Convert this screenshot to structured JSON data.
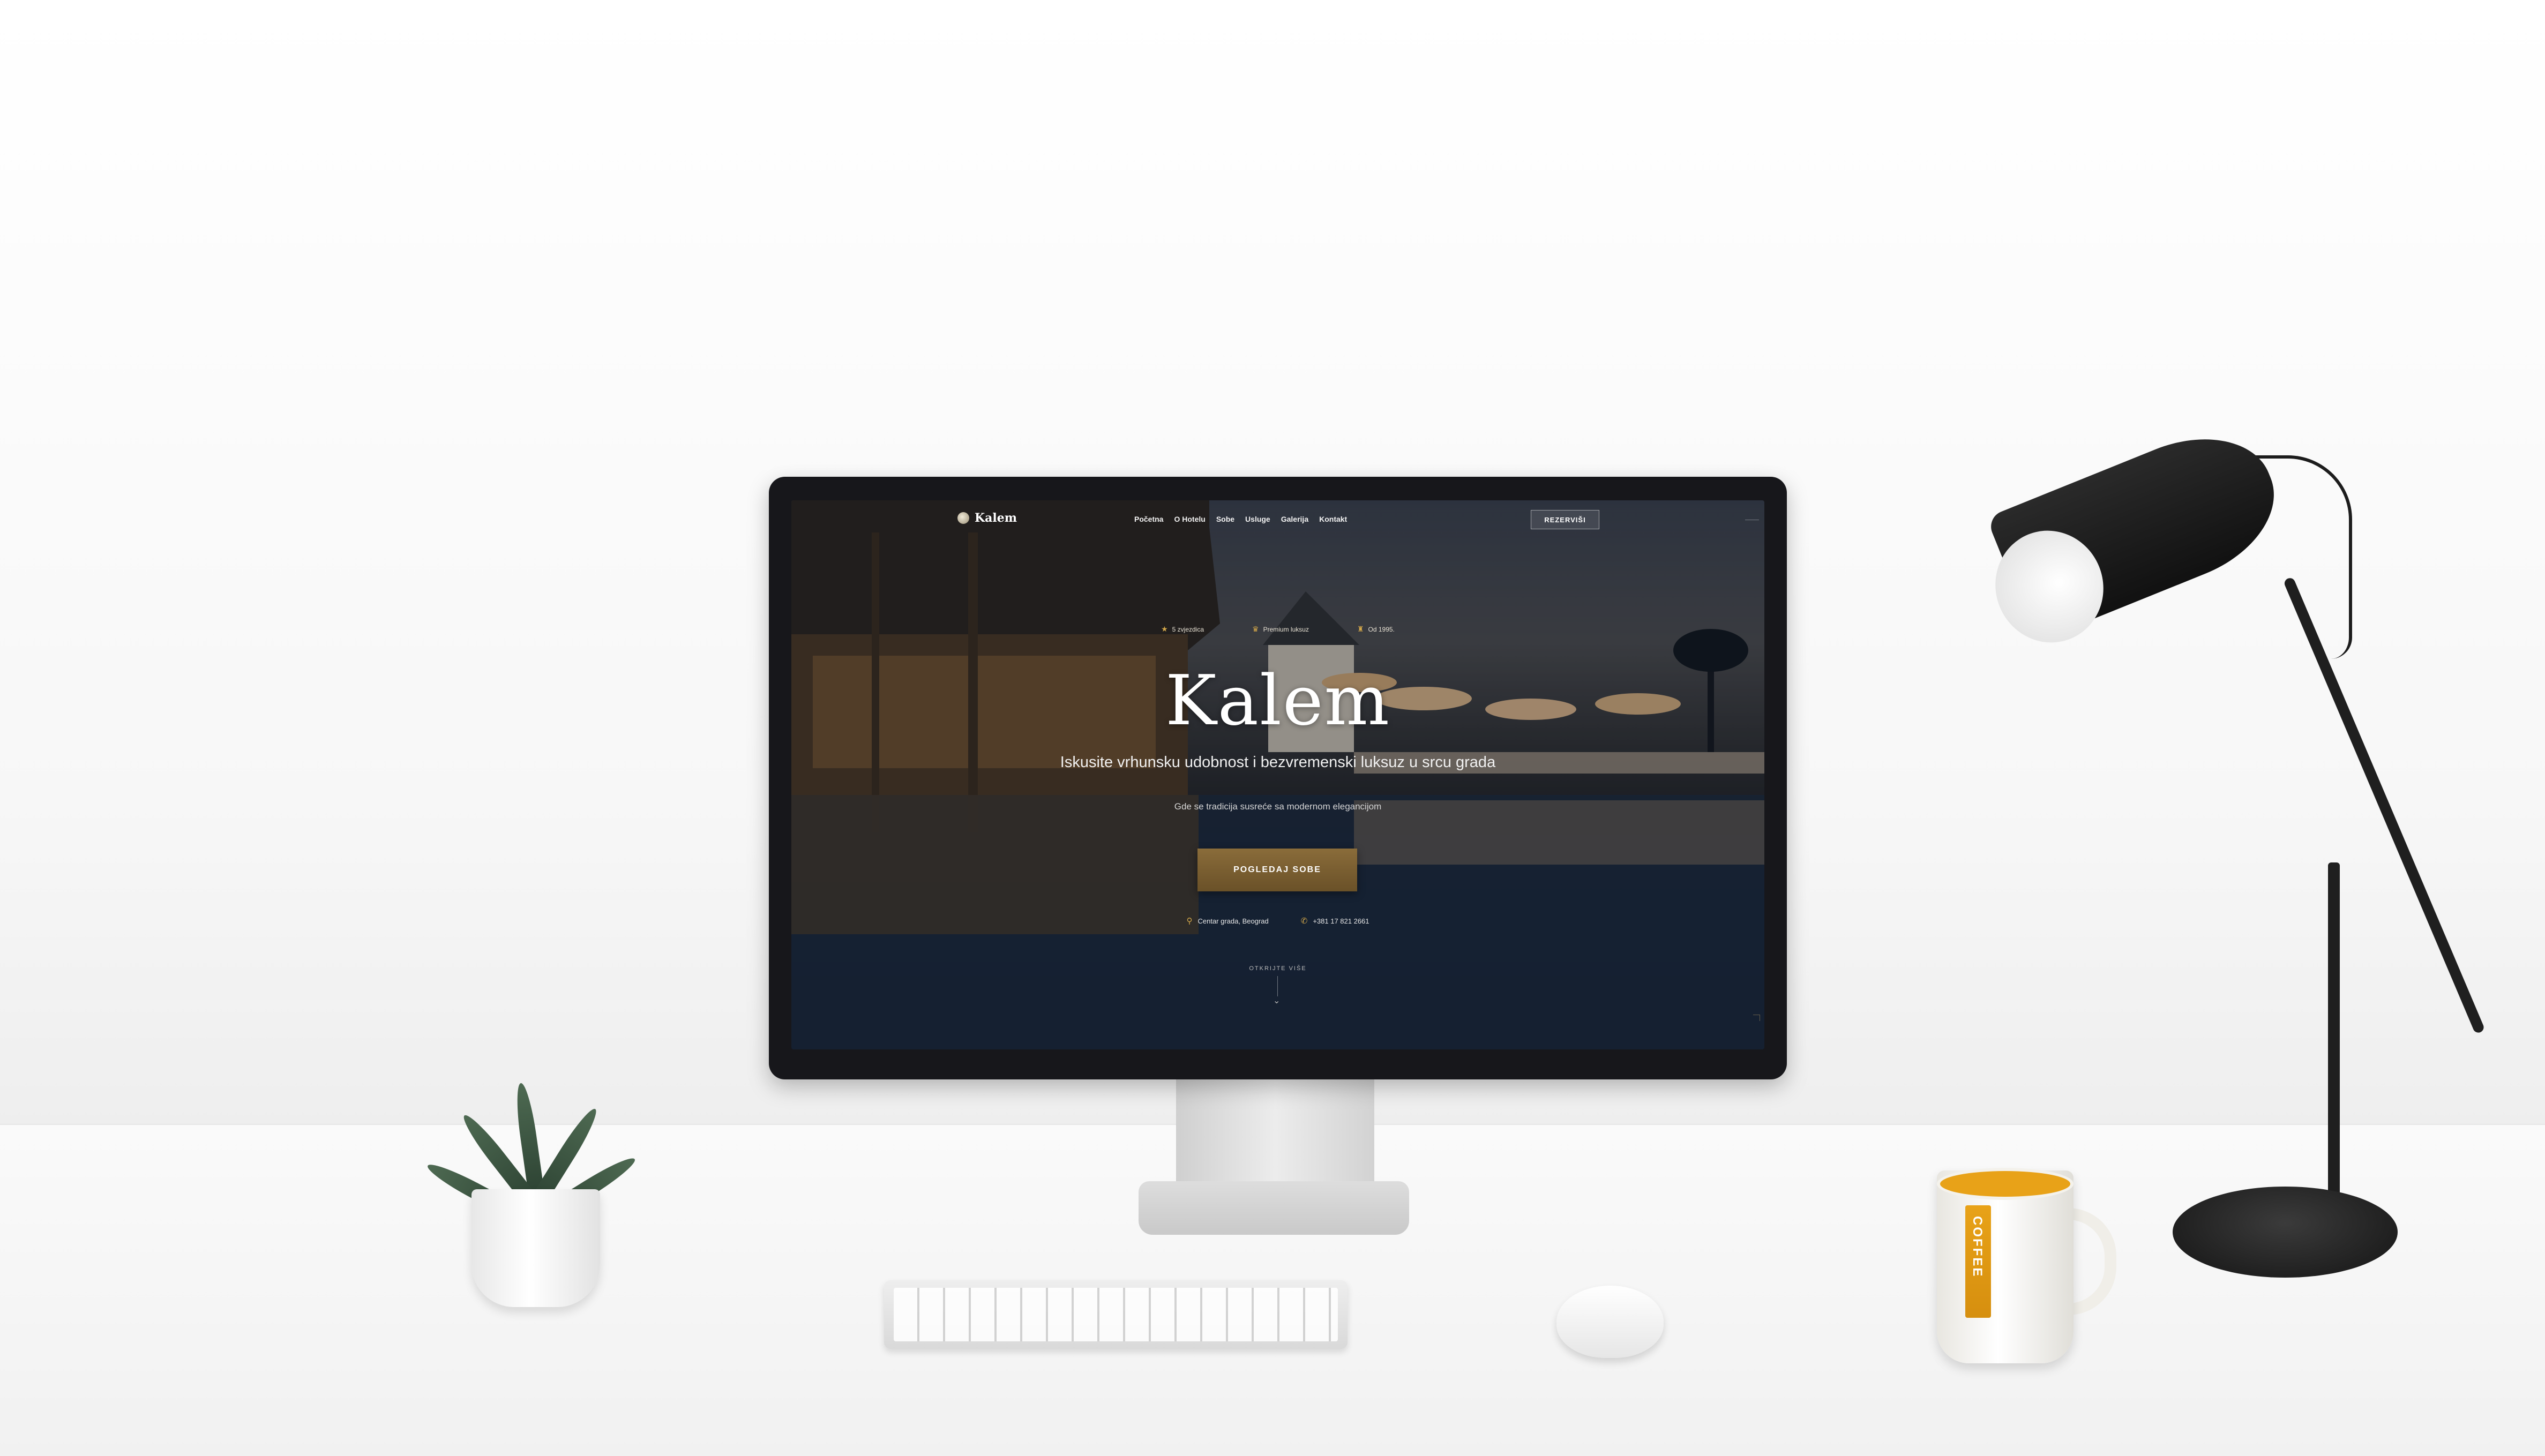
{
  "website": {
    "brand": "Kalem",
    "nav": [
      "Početna",
      "O Hotelu",
      "Sobe",
      "Usluge",
      "Galerija",
      "Kontakt"
    ],
    "book_button": "REZERVIŠI",
    "badges": [
      {
        "icon": "star-icon",
        "label": "5 zvjezdica"
      },
      {
        "icon": "crown-icon",
        "label": "Premium luksuz"
      },
      {
        "icon": "award-icon",
        "label": "Od 1995."
      }
    ],
    "hero_title": "Kalem",
    "hero_subtitle": "Iskusite vrhunsku udobnost i bezvremenski luksuz u srcu grada",
    "hero_tagline": "Gde se tradicija susreće sa modernom elegancijom",
    "cta": "POGLEDAJ SOBE",
    "contact": {
      "location_icon": "map-pin-icon",
      "location": "Centar grada, Beograd",
      "phone_icon": "phone-icon",
      "phone": "+381 17 821 2661"
    },
    "scroll_hint": "OTKRIJTE VIŠE"
  },
  "props": {
    "mug_text": "COFFEE"
  },
  "colors": {
    "accent_gold": "#d4a84a",
    "cta_bg": "#7a5f31",
    "mug_orange": "#e8a218"
  }
}
